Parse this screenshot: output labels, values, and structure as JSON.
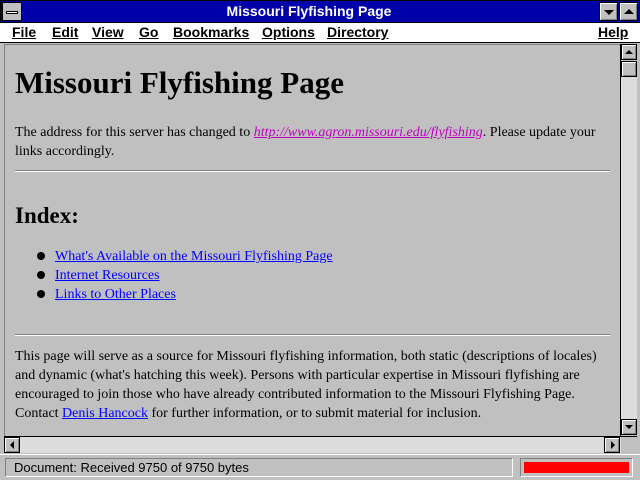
{
  "window": {
    "title": "Missouri Flyfishing Page"
  },
  "menu": [
    {
      "id": "file",
      "label": "File"
    },
    {
      "id": "edit",
      "label": "Edit"
    },
    {
      "id": "view",
      "label": "View"
    },
    {
      "id": "go",
      "label": "Go"
    },
    {
      "id": "bookmarks",
      "label": "Bookmarks"
    },
    {
      "id": "options",
      "label": "Options"
    },
    {
      "id": "directory",
      "label": "Directory"
    },
    {
      "id": "help",
      "label": "Help"
    }
  ],
  "page": {
    "heading": "Missouri Flyfishing Page",
    "notice_prefix": "The address for this server has changed to ",
    "notice_url": "http://www.agron.missouri.edu/flyfishing",
    "notice_suffix": ". Please update your links accordingly.",
    "index_heading": "Index:",
    "index_links": [
      "What's Available on the Missouri Flyfishing Page",
      "Internet Resources",
      "Links to Other Places"
    ],
    "description_prefix": "This page will serve as a source for Missouri flyfishing information, both static (descriptions of locales) and dynamic (what's hatching this week). Persons with particular expertise in Missouri flyfishing are encouraged to join those who have already contributed information to the Missouri Flyfishing Page. Contact ",
    "contact_link": "Denis Hancock",
    "description_suffix": " for further information, or to submit material for inclusion."
  },
  "status": {
    "text": "Document: Received 9750 of 9750 bytes",
    "progress_fraction": 1.0,
    "progress_color": "#ff0000"
  },
  "colors": {
    "title_bar": "#0000a8",
    "link": "#0000ff",
    "visited_link": "#c000c0",
    "background": "#c0c0c0"
  }
}
